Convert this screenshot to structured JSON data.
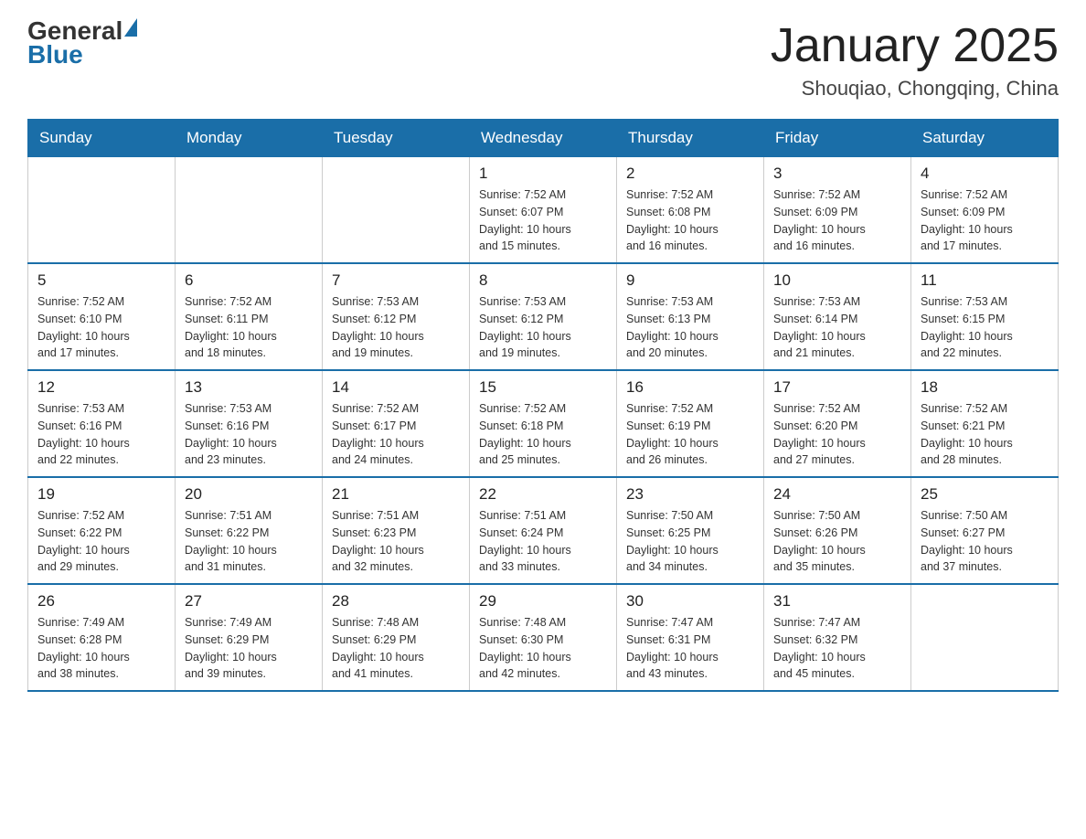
{
  "header": {
    "logo_general": "General",
    "logo_blue": "Blue",
    "title": "January 2025",
    "subtitle": "Shouqiao, Chongqing, China"
  },
  "weekdays": [
    "Sunday",
    "Monday",
    "Tuesday",
    "Wednesday",
    "Thursday",
    "Friday",
    "Saturday"
  ],
  "weeks": [
    [
      {
        "day": "",
        "info": ""
      },
      {
        "day": "",
        "info": ""
      },
      {
        "day": "",
        "info": ""
      },
      {
        "day": "1",
        "info": "Sunrise: 7:52 AM\nSunset: 6:07 PM\nDaylight: 10 hours\nand 15 minutes."
      },
      {
        "day": "2",
        "info": "Sunrise: 7:52 AM\nSunset: 6:08 PM\nDaylight: 10 hours\nand 16 minutes."
      },
      {
        "day": "3",
        "info": "Sunrise: 7:52 AM\nSunset: 6:09 PM\nDaylight: 10 hours\nand 16 minutes."
      },
      {
        "day": "4",
        "info": "Sunrise: 7:52 AM\nSunset: 6:09 PM\nDaylight: 10 hours\nand 17 minutes."
      }
    ],
    [
      {
        "day": "5",
        "info": "Sunrise: 7:52 AM\nSunset: 6:10 PM\nDaylight: 10 hours\nand 17 minutes."
      },
      {
        "day": "6",
        "info": "Sunrise: 7:52 AM\nSunset: 6:11 PM\nDaylight: 10 hours\nand 18 minutes."
      },
      {
        "day": "7",
        "info": "Sunrise: 7:53 AM\nSunset: 6:12 PM\nDaylight: 10 hours\nand 19 minutes."
      },
      {
        "day": "8",
        "info": "Sunrise: 7:53 AM\nSunset: 6:12 PM\nDaylight: 10 hours\nand 19 minutes."
      },
      {
        "day": "9",
        "info": "Sunrise: 7:53 AM\nSunset: 6:13 PM\nDaylight: 10 hours\nand 20 minutes."
      },
      {
        "day": "10",
        "info": "Sunrise: 7:53 AM\nSunset: 6:14 PM\nDaylight: 10 hours\nand 21 minutes."
      },
      {
        "day": "11",
        "info": "Sunrise: 7:53 AM\nSunset: 6:15 PM\nDaylight: 10 hours\nand 22 minutes."
      }
    ],
    [
      {
        "day": "12",
        "info": "Sunrise: 7:53 AM\nSunset: 6:16 PM\nDaylight: 10 hours\nand 22 minutes."
      },
      {
        "day": "13",
        "info": "Sunrise: 7:53 AM\nSunset: 6:16 PM\nDaylight: 10 hours\nand 23 minutes."
      },
      {
        "day": "14",
        "info": "Sunrise: 7:52 AM\nSunset: 6:17 PM\nDaylight: 10 hours\nand 24 minutes."
      },
      {
        "day": "15",
        "info": "Sunrise: 7:52 AM\nSunset: 6:18 PM\nDaylight: 10 hours\nand 25 minutes."
      },
      {
        "day": "16",
        "info": "Sunrise: 7:52 AM\nSunset: 6:19 PM\nDaylight: 10 hours\nand 26 minutes."
      },
      {
        "day": "17",
        "info": "Sunrise: 7:52 AM\nSunset: 6:20 PM\nDaylight: 10 hours\nand 27 minutes."
      },
      {
        "day": "18",
        "info": "Sunrise: 7:52 AM\nSunset: 6:21 PM\nDaylight: 10 hours\nand 28 minutes."
      }
    ],
    [
      {
        "day": "19",
        "info": "Sunrise: 7:52 AM\nSunset: 6:22 PM\nDaylight: 10 hours\nand 29 minutes."
      },
      {
        "day": "20",
        "info": "Sunrise: 7:51 AM\nSunset: 6:22 PM\nDaylight: 10 hours\nand 31 minutes."
      },
      {
        "day": "21",
        "info": "Sunrise: 7:51 AM\nSunset: 6:23 PM\nDaylight: 10 hours\nand 32 minutes."
      },
      {
        "day": "22",
        "info": "Sunrise: 7:51 AM\nSunset: 6:24 PM\nDaylight: 10 hours\nand 33 minutes."
      },
      {
        "day": "23",
        "info": "Sunrise: 7:50 AM\nSunset: 6:25 PM\nDaylight: 10 hours\nand 34 minutes."
      },
      {
        "day": "24",
        "info": "Sunrise: 7:50 AM\nSunset: 6:26 PM\nDaylight: 10 hours\nand 35 minutes."
      },
      {
        "day": "25",
        "info": "Sunrise: 7:50 AM\nSunset: 6:27 PM\nDaylight: 10 hours\nand 37 minutes."
      }
    ],
    [
      {
        "day": "26",
        "info": "Sunrise: 7:49 AM\nSunset: 6:28 PM\nDaylight: 10 hours\nand 38 minutes."
      },
      {
        "day": "27",
        "info": "Sunrise: 7:49 AM\nSunset: 6:29 PM\nDaylight: 10 hours\nand 39 minutes."
      },
      {
        "day": "28",
        "info": "Sunrise: 7:48 AM\nSunset: 6:29 PM\nDaylight: 10 hours\nand 41 minutes."
      },
      {
        "day": "29",
        "info": "Sunrise: 7:48 AM\nSunset: 6:30 PM\nDaylight: 10 hours\nand 42 minutes."
      },
      {
        "day": "30",
        "info": "Sunrise: 7:47 AM\nSunset: 6:31 PM\nDaylight: 10 hours\nand 43 minutes."
      },
      {
        "day": "31",
        "info": "Sunrise: 7:47 AM\nSunset: 6:32 PM\nDaylight: 10 hours\nand 45 minutes."
      },
      {
        "day": "",
        "info": ""
      }
    ]
  ]
}
